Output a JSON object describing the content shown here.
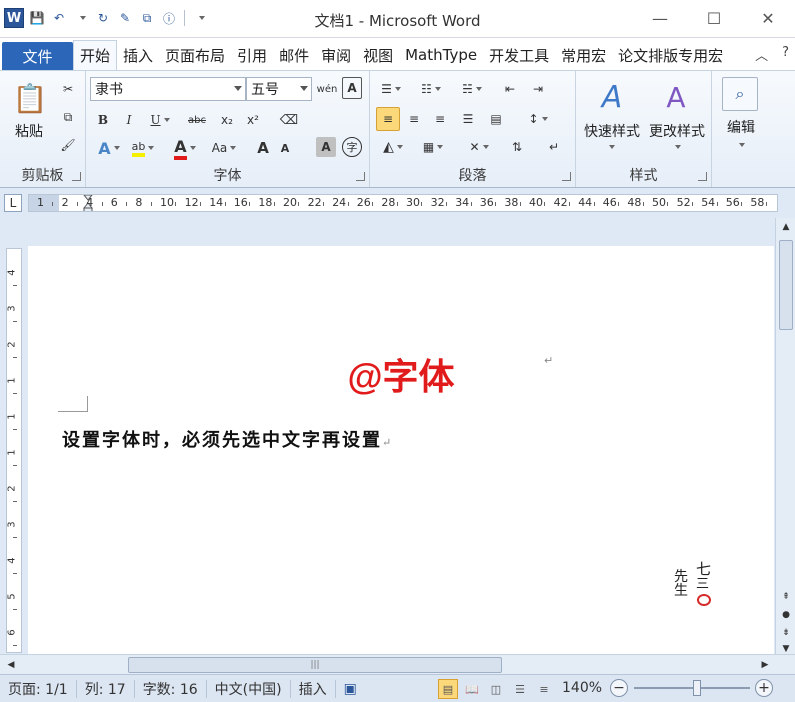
{
  "window": {
    "title": "文档1 - Microsoft Word",
    "minimize": "—",
    "maximize": "☐",
    "close": "✕"
  },
  "qat": {
    "app_icon": "W",
    "save": "💾",
    "undo": "↶",
    "redo": "↻"
  },
  "tabs": [
    "文件",
    "开始",
    "插入",
    "页面布局",
    "引用",
    "邮件",
    "审阅",
    "视图",
    "MathType",
    "开发工具",
    "常用宏",
    "论文排版专用宏"
  ],
  "tabs_right": {
    "collapse": "︿",
    "help": "?"
  },
  "clipboard": {
    "paste_label": "粘贴",
    "group_label": "剪贴板"
  },
  "font": {
    "name": "隶书",
    "size": "五号",
    "group_label": "字体",
    "bold": "B",
    "italic": "I",
    "underline": "U",
    "strike": "abc",
    "subscript": "x₂",
    "superscript": "x²",
    "font_color_glyph": "A",
    "case_label": "Aa",
    "grow": "A",
    "shrink": "A",
    "char_border": "A",
    "enclose": "字",
    "phonetic": "wén",
    "clear": "A"
  },
  "paragraph": {
    "group_label": "段落"
  },
  "styles": {
    "quick_label": "快速样式",
    "change_label": "更改样式",
    "group_label": "样式"
  },
  "editing": {
    "label": "编辑"
  },
  "ruler": {
    "corner": "L",
    "numbers": [
      "1",
      "2",
      "4",
      "6",
      "8",
      "10",
      "12",
      "14",
      "16",
      "18",
      "20",
      "22",
      "24",
      "26",
      "28",
      "30",
      "32",
      "34",
      "36",
      "38",
      "40",
      "42",
      "44",
      "46",
      "48",
      "50",
      "52",
      "54",
      "56",
      "58"
    ],
    "vnumbers": [
      "4",
      "3",
      "2",
      "1",
      "1",
      "1",
      "2",
      "3",
      "4",
      "5",
      "6"
    ]
  },
  "document": {
    "title": "@字体",
    "body": "设置字体时，必须先选中文字再设置",
    "paragraph_mark": "↵",
    "signature": "七三先生"
  },
  "status": {
    "page": "页面: 1/1",
    "column": "列: 17",
    "words": "字数: 16",
    "language": "中文(中国)",
    "mode": "插入",
    "zoom": "140%"
  },
  "colors": {
    "accent": "#2b579a",
    "title_red": "#e11b1b",
    "file_tab": "#2b66b8"
  }
}
